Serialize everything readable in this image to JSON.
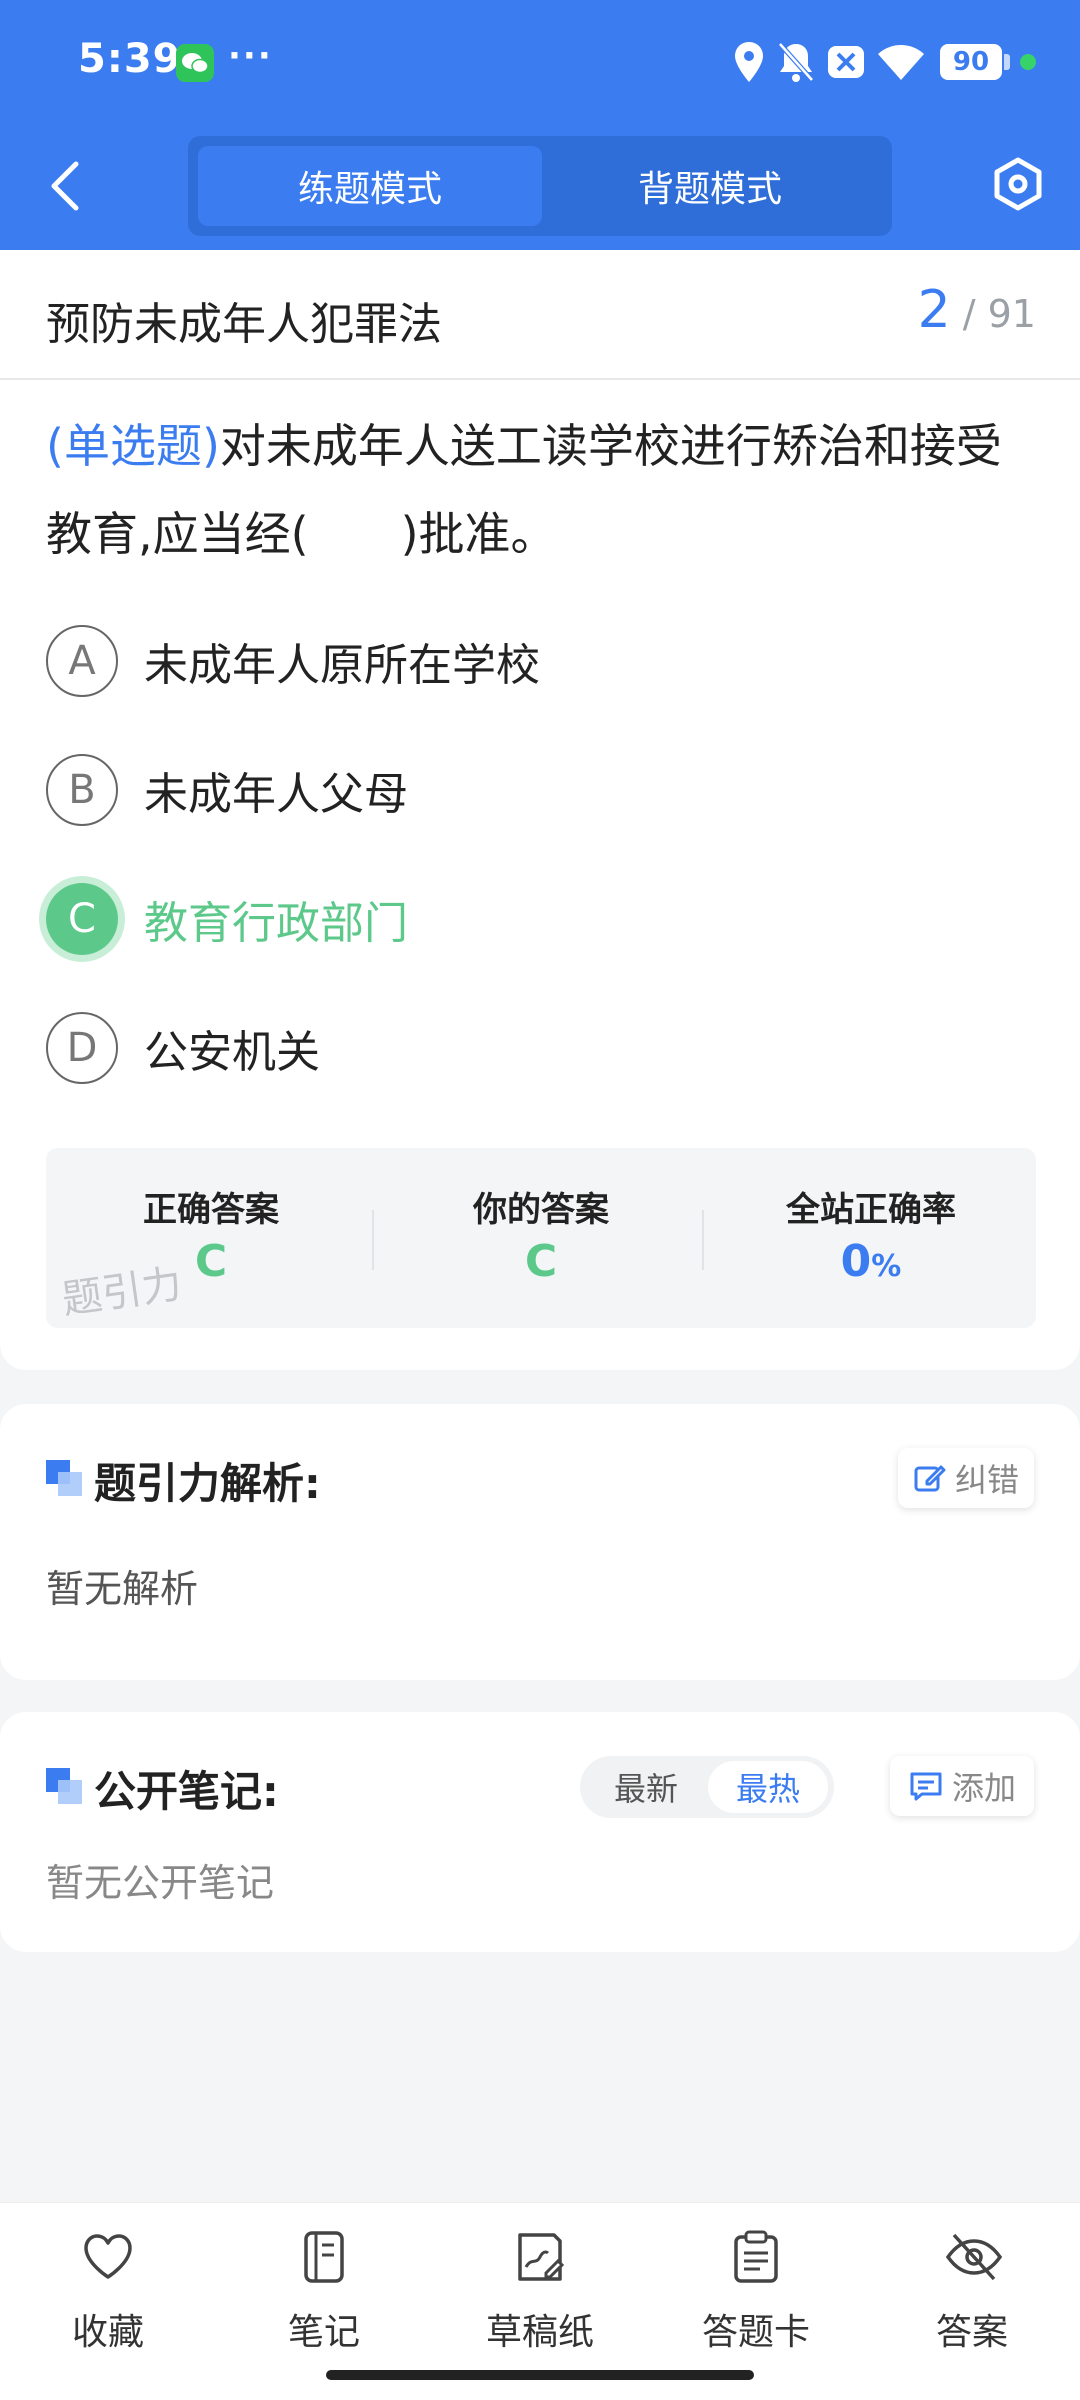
{
  "status": {
    "time": "5:39",
    "dots": "···",
    "battery": "90"
  },
  "nav": {
    "mode_practice": "练题模式",
    "mode_recite": "背题模式"
  },
  "question": {
    "subject": "预防未成年人犯罪法",
    "current": "2",
    "total": "/ 91",
    "type": "(单选题)",
    "text": "对未成年人送工读学校进行矫治和接受教育,应当经(　　)批准。",
    "options": [
      {
        "letter": "A",
        "text": "未成年人原所在学校"
      },
      {
        "letter": "B",
        "text": "未成年人父母"
      },
      {
        "letter": "C",
        "text": "教育行政部门"
      },
      {
        "letter": "D",
        "text": "公安机关"
      }
    ]
  },
  "result": {
    "correct_label": "正确答案",
    "correct_value": "C",
    "yours_label": "你的答案",
    "yours_value": "C",
    "rate_label": "全站正确率",
    "rate_value": "0",
    "rate_unit": "%",
    "watermark": "题引力"
  },
  "analysis": {
    "title": "题引力解析:",
    "correct_btn": "纠错",
    "empty": "暂无解析"
  },
  "notes": {
    "title": "公开笔记:",
    "sort_new": "最新",
    "sort_hot": "最热",
    "add_btn": "添加",
    "empty": "暂无公开笔记"
  },
  "tabs": [
    {
      "label": "收藏",
      "icon": "heart-icon"
    },
    {
      "label": "笔记",
      "icon": "notebook-icon"
    },
    {
      "label": "草稿纸",
      "icon": "draft-icon"
    },
    {
      "label": "答题卡",
      "icon": "clipboard-icon"
    },
    {
      "label": "答案",
      "icon": "eye-off-icon"
    }
  ],
  "colors": {
    "primary": "#3b7df0",
    "correct": "#5cc98a"
  }
}
